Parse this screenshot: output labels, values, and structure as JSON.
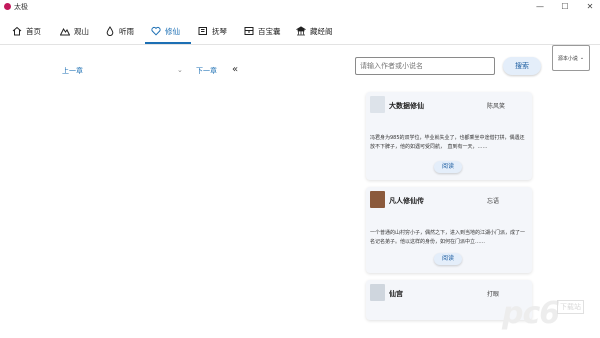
{
  "window": {
    "title": "太极",
    "minimize": "—",
    "maximize": "☐",
    "close": "✕"
  },
  "nav": {
    "tabs": [
      {
        "label": "首页",
        "icon": "home-icon"
      },
      {
        "label": "观山",
        "icon": "mountain-icon"
      },
      {
        "label": "听雨",
        "icon": "drop-icon"
      },
      {
        "label": "修仙",
        "icon": "heart-icon",
        "active": true
      },
      {
        "label": "抚琴",
        "icon": "book-icon"
      },
      {
        "label": "百宝囊",
        "icon": "box-icon"
      },
      {
        "label": "藏经阁",
        "icon": "temple-icon"
      }
    ],
    "accent_color": "#1c6fb4"
  },
  "reader": {
    "prev_chapter": "上一章",
    "next_chapter": "下一章",
    "collapse": "«"
  },
  "search": {
    "placeholder": "请输入作者或小说名",
    "button": "搜索",
    "mode": "源本小说"
  },
  "books": [
    {
      "title": "大数据修仙",
      "author": "陈风笑",
      "desc": "冯君身为985的双学位，毕业就失业了，也都乘坐中途借打拼，偶遇还放不下脾子，他的如遇可受同航，　直到有一天，……",
      "read": "阅读"
    },
    {
      "title": "凡人修仙传",
      "author": "忘语",
      "desc": "一个普通的山村穷小子，偶然之下，进入到当地的江湖小门派，成了一名记名弟子。他以这样的身份，如何在门派中立……",
      "read": "阅读"
    },
    {
      "title": "仙宫",
      "author": "打眼",
      "desc": "",
      "read": ""
    }
  ],
  "watermark": {
    "logo": "pc6",
    "sub": "下载站"
  }
}
